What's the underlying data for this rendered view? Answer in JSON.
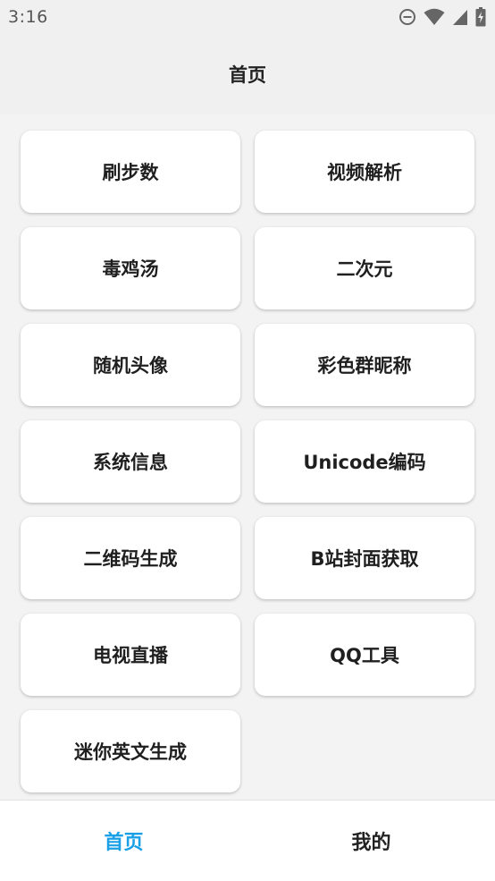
{
  "status_bar": {
    "time": "3:16",
    "icons": [
      "do-not-disturb-icon",
      "wifi-icon",
      "cellular-signal-icon",
      "battery-charging-icon"
    ]
  },
  "header": {
    "title": "首页"
  },
  "tiles": [
    {
      "label": "刷步数"
    },
    {
      "label": "视频解析"
    },
    {
      "label": "毒鸡汤"
    },
    {
      "label": "二次元"
    },
    {
      "label": "随机头像"
    },
    {
      "label": "彩色群昵称"
    },
    {
      "label": "系统信息"
    },
    {
      "label": "Unicode编码"
    },
    {
      "label": "二维码生成"
    },
    {
      "label": "B站封面获取"
    },
    {
      "label": "电视直播"
    },
    {
      "label": "QQ工具"
    },
    {
      "label": "迷你英文生成"
    }
  ],
  "bottom_nav": {
    "items": [
      {
        "label": "首页",
        "active": true
      },
      {
        "label": "我的",
        "active": false
      }
    ],
    "active_color": "#1aa0e6"
  }
}
